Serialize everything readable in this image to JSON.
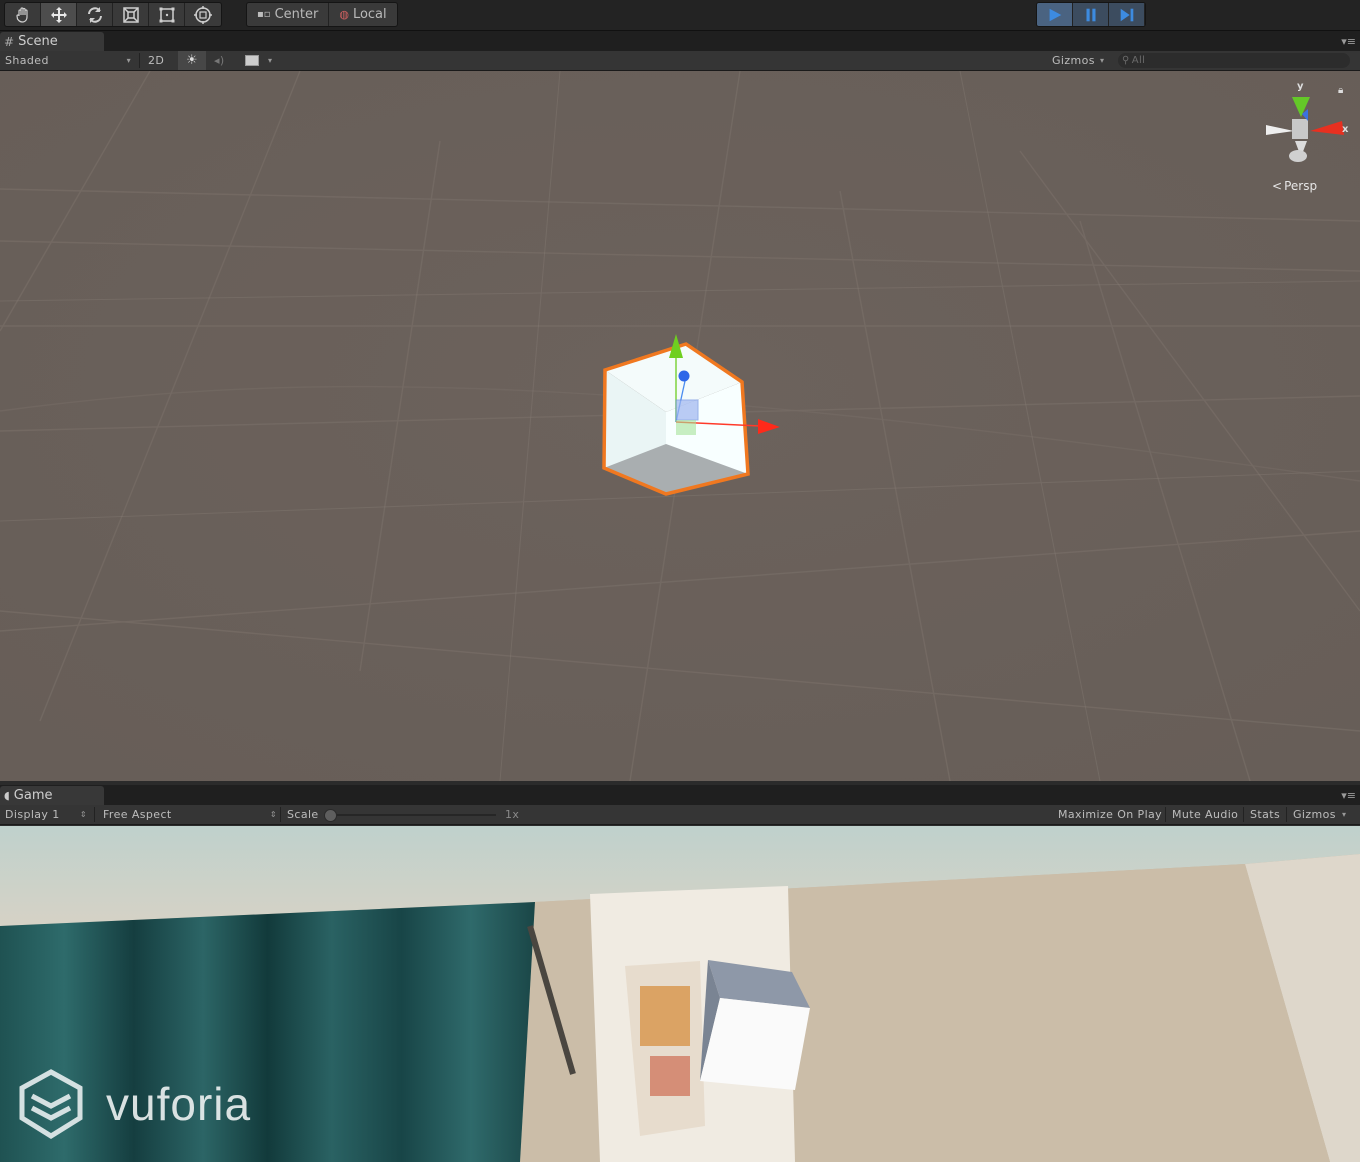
{
  "toolbar": {
    "tools": [
      {
        "icon": "hand-tool-icon"
      },
      {
        "icon": "move-tool-icon"
      },
      {
        "icon": "rotate-tool-icon"
      },
      {
        "icon": "scale-tool-icon"
      },
      {
        "icon": "rect-tool-icon"
      },
      {
        "icon": "transform-tool-icon"
      }
    ],
    "pivot_label": "Center",
    "space_label": "Local",
    "play_controls": [
      "play-icon",
      "pause-icon",
      "step-icon"
    ],
    "accent_color": "#3d8be0"
  },
  "scene": {
    "tab_label": "Scene",
    "shading_mode": "Shaded",
    "mode_2d": "2D",
    "gizmos_label": "Gizmos",
    "search_placeholder": "All",
    "projection_label": "Persp",
    "axis_y": "y",
    "axis_x": "x",
    "selection_color": "#f07820"
  },
  "game": {
    "tab_label": "Game",
    "display": "Display 1",
    "aspect": "Free Aspect",
    "scale_label": "Scale",
    "scale_value": "1x",
    "maximize_on_play": "Maximize On Play",
    "mute_audio": "Mute Audio",
    "stats": "Stats",
    "gizmos_label": "Gizmos",
    "watermark": "vuforia"
  }
}
